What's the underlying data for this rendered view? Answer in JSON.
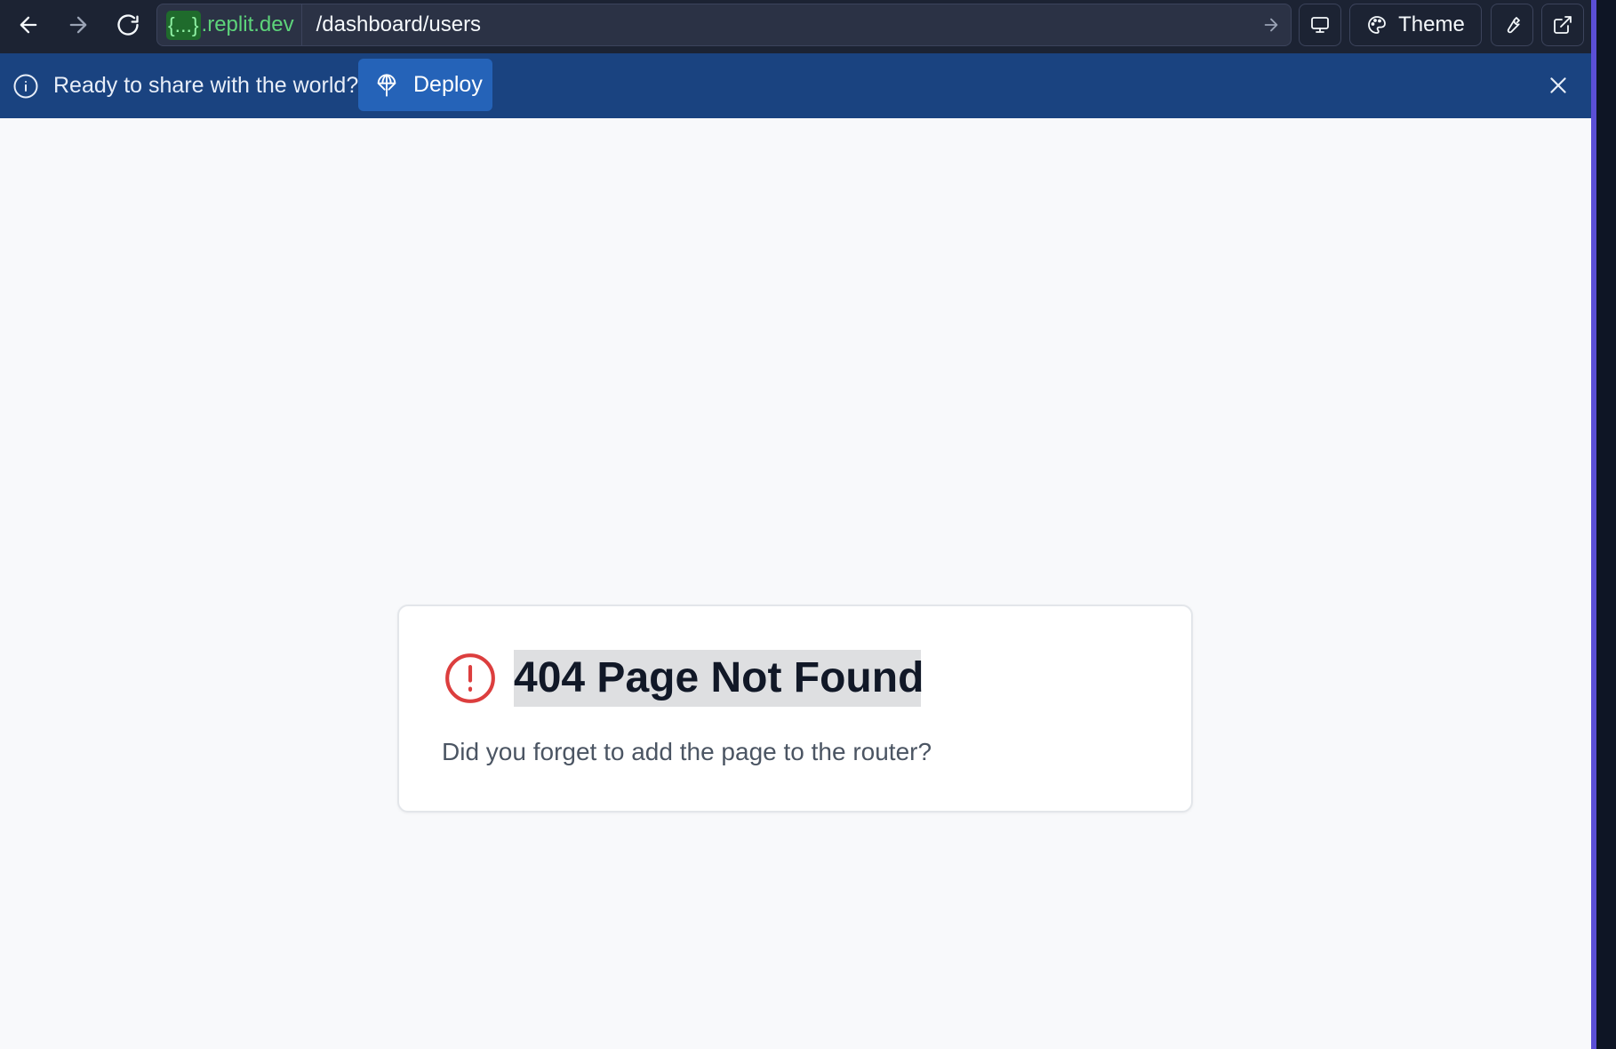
{
  "browser": {
    "domain_badge": "{...}",
    "domain": ".replit.dev",
    "path": "/dashboard/users",
    "theme_label": "Theme"
  },
  "banner": {
    "message": "Ready to share with the world?",
    "deploy_label": "Deploy"
  },
  "error_card": {
    "title": "404 Page Not Found",
    "description": "Did you forget to add the page to the router?"
  },
  "colors": {
    "toolbar_bg": "#1c2333",
    "banner_bg": "#1a4380",
    "deploy_bg": "#2563b8",
    "alert_red": "#dc3e3e",
    "domain_green": "#5dd47a"
  },
  "icons": [
    "back-arrow-icon",
    "forward-arrow-icon",
    "reload-icon",
    "url-go-arrow-icon",
    "monitor-icon",
    "palette-icon",
    "wrench-icon",
    "external-link-icon",
    "info-icon",
    "deploy-icon",
    "close-icon",
    "alert-circle-icon"
  ]
}
